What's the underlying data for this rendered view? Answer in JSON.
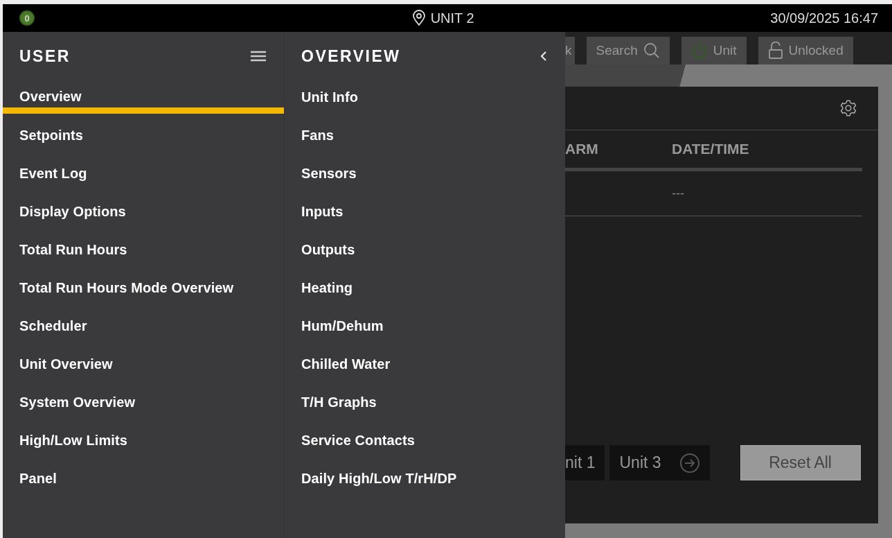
{
  "status_bar": {
    "alarm_count": "0",
    "location": "UNIT 2",
    "datetime": "30/09/2025 16:47"
  },
  "user_menu": {
    "title": "USER",
    "items": [
      {
        "label": "Overview",
        "selected": true
      },
      {
        "label": "Setpoints",
        "selected": false
      },
      {
        "label": "Event Log",
        "selected": false
      },
      {
        "label": "Display Options",
        "selected": false
      },
      {
        "label": "Total Run Hours",
        "selected": false
      },
      {
        "label": "Total Run Hours Mode Overview",
        "selected": false
      },
      {
        "label": "Scheduler",
        "selected": false
      },
      {
        "label": "Unit Overview",
        "selected": false
      },
      {
        "label": "System Overview",
        "selected": false
      },
      {
        "label": "High/Low Limits",
        "selected": false
      },
      {
        "label": "Panel",
        "selected": false
      }
    ]
  },
  "overview_menu": {
    "title": "OVERVIEW",
    "items": [
      {
        "label": "Unit Info"
      },
      {
        "label": "Fans"
      },
      {
        "label": "Sensors"
      },
      {
        "label": "Inputs"
      },
      {
        "label": "Outputs"
      },
      {
        "label": "Heating"
      },
      {
        "label": "Hum/Dehum"
      },
      {
        "label": "Chilled Water"
      },
      {
        "label": "T/H Graphs"
      },
      {
        "label": "Service Contacts"
      },
      {
        "label": "Daily High/Low T/rH/DP"
      }
    ]
  },
  "background": {
    "toolbar": [
      {
        "label": "k",
        "kind": "plain"
      },
      {
        "label": "Search",
        "kind": "search"
      },
      {
        "label": "Unit",
        "kind": "power"
      },
      {
        "label": "Unlocked",
        "kind": "lock"
      }
    ],
    "table": {
      "columns": [
        "ARM",
        "DATE/TIME"
      ],
      "rows": [
        {
          "date_time": "---"
        }
      ]
    },
    "unit_buttons": [
      {
        "label": "nit 1",
        "kind": "plain"
      },
      {
        "label": "Unit 3",
        "kind": "next"
      }
    ],
    "reset_button": "Reset All"
  }
}
